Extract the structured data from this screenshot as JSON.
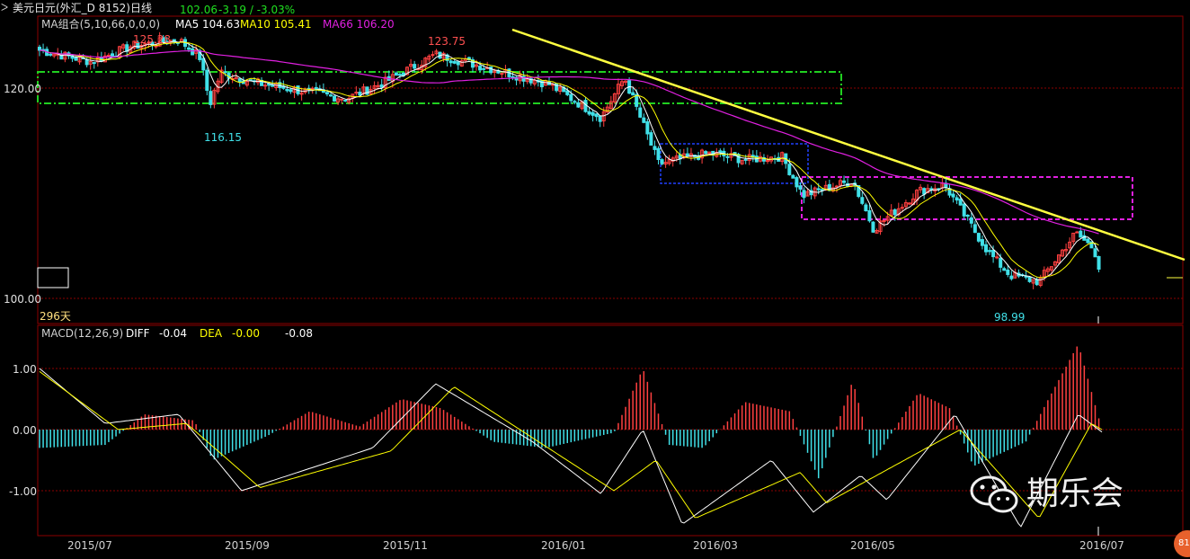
{
  "header": {
    "instrument_code_prefix": "ᐳ",
    "instrument": "美元日元(外汇_D 8152)日线",
    "last": "102.06",
    "change": "-3.19 / -3.03%"
  },
  "ma_legend": {
    "name": "MA组合(5,10,66,0,0,0)",
    "ma5": "MA5 104.63",
    "ma10": "MA10 105.41",
    "ma66": "MA66 106.20"
  },
  "macd_legend": {
    "name": "MACD(12,26,9)",
    "diff_label": "DIFF",
    "diff_value": "-0.04",
    "dea_label": "DEA",
    "dea_value": "-0.00",
    "macd_value": "-0.08"
  },
  "price_panel": {
    "y_ticks": [
      "120.00",
      "100.00"
    ],
    "annotations": {
      "high1": "125.28",
      "high2": "123.75",
      "low1": "116.15",
      "low2": "98.99"
    },
    "days_label": "296天"
  },
  "macd_panel": {
    "y_ticks": [
      "1.00",
      "0.00",
      "-1.00"
    ]
  },
  "x_axis": {
    "labels": [
      "2015/07",
      "2015/09",
      "2015/11",
      "2016/01",
      "2016/03",
      "2016/05",
      "2016/07"
    ]
  },
  "watermark": {
    "text": "期乐会"
  },
  "badge": {
    "text": "81"
  },
  "colors": {
    "bull": "#ff4040",
    "bear": "#40e0e8",
    "ma5": "#ffffff",
    "ma10": "#ffff00",
    "ma66": "#e020e0",
    "trendline": "#ffff40",
    "grid": "#8b0000",
    "box_green": "#20d020",
    "box_blue": "#2040ff",
    "box_magenta": "#e020e0"
  },
  "chart_data": {
    "type": "candlestick",
    "title": "美元日元(外汇_D 8152)日线",
    "price_ylim": [
      98,
      126.5
    ],
    "macd_ylim": [
      -1.75,
      1.1
    ],
    "x_range": [
      "2015/07",
      "2016/07"
    ],
    "price_anchors": [
      {
        "date": "2015/06/20",
        "close": 123.6
      },
      {
        "date": "2015/07/10",
        "close": 122.5
      },
      {
        "date": "2015/07/25",
        "close": 124.0
      },
      {
        "date": "2015/08/12",
        "close": 124.6
      },
      {
        "date": "2015/08/20",
        "close": 123.0
      },
      {
        "date": "2015/08/24",
        "close": 118.5
      },
      {
        "date": "2015/08/28",
        "close": 121.5
      },
      {
        "date": "2015/09/10",
        "close": 120.5
      },
      {
        "date": "2015/10/15",
        "close": 119.0
      },
      {
        "date": "2015/10/30",
        "close": 120.6
      },
      {
        "date": "2015/11/18",
        "close": 123.2
      },
      {
        "date": "2015/12/10",
        "close": 121.8
      },
      {
        "date": "2015/12/31",
        "close": 120.4
      },
      {
        "date": "2016/01/20",
        "close": 117.2
      },
      {
        "date": "2016/01/29",
        "close": 121.0
      },
      {
        "date": "2016/02/11",
        "close": 112.8
      },
      {
        "date": "2016/03/01",
        "close": 113.8
      },
      {
        "date": "2016/03/15",
        "close": 113.2
      },
      {
        "date": "2016/03/29",
        "close": 113.5
      },
      {
        "date": "2016/04/06",
        "close": 109.8
      },
      {
        "date": "2016/04/25",
        "close": 111.2
      },
      {
        "date": "2016/05/03",
        "close": 106.6
      },
      {
        "date": "2016/05/20",
        "close": 110.2
      },
      {
        "date": "2016/05/30",
        "close": 110.8
      },
      {
        "date": "2016/06/16",
        "close": 104.3
      },
      {
        "date": "2016/06/24",
        "close": 102.2
      },
      {
        "date": "2016/07/05",
        "close": 101.6
      },
      {
        "date": "2016/07/19",
        "close": 106.2
      },
      {
        "date": "2016/07/26",
        "close": 104.7
      },
      {
        "date": "2016/07/29",
        "close": 102.06
      }
    ],
    "macd_hist_anchors": [
      {
        "date": "2015/06/20",
        "value": -0.3
      },
      {
        "date": "2015/07/15",
        "value": -0.25
      },
      {
        "date": "2015/07/30",
        "value": 0.25
      },
      {
        "date": "2015/08/18",
        "value": 0.15
      },
      {
        "date": "2015/08/25",
        "value": -0.5
      },
      {
        "date": "2015/09/15",
        "value": -0.1
      },
      {
        "date": "2015/10/01",
        "value": 0.3
      },
      {
        "date": "2015/10/20",
        "value": 0.05
      },
      {
        "date": "2015/11/05",
        "value": 0.5
      },
      {
        "date": "2015/11/20",
        "value": 0.35
      },
      {
        "date": "2015/12/10",
        "value": -0.2
      },
      {
        "date": "2015/12/30",
        "value": -0.3
      },
      {
        "date": "2016/01/25",
        "value": -0.05
      },
      {
        "date": "2016/02/05",
        "value": 1.0
      },
      {
        "date": "2016/02/15",
        "value": -0.25
      },
      {
        "date": "2016/02/28",
        "value": -0.3
      },
      {
        "date": "2016/03/15",
        "value": 0.45
      },
      {
        "date": "2016/04/01",
        "value": 0.3
      },
      {
        "date": "2016/04/12",
        "value": -0.8
      },
      {
        "date": "2016/04/25",
        "value": 0.8
      },
      {
        "date": "2016/05/03",
        "value": -0.5
      },
      {
        "date": "2016/05/20",
        "value": 0.6
      },
      {
        "date": "2016/06/01",
        "value": 0.35
      },
      {
        "date": "2016/06/10",
        "value": -0.6
      },
      {
        "date": "2016/06/30",
        "value": -0.2
      },
      {
        "date": "2016/07/08",
        "value": 0.45
      },
      {
        "date": "2016/07/20",
        "value": 1.4
      },
      {
        "date": "2016/07/29",
        "value": 0.0
      }
    ],
    "diff_anchors": [
      {
        "date": "2015/06/20",
        "value": 1.0
      },
      {
        "date": "2015/07/15",
        "value": 0.1
      },
      {
        "date": "2015/08/12",
        "value": 0.25
      },
      {
        "date": "2015/09/05",
        "value": -1.0
      },
      {
        "date": "2015/10/25",
        "value": -0.3
      },
      {
        "date": "2015/11/18",
        "value": 0.75
      },
      {
        "date": "2015/12/25",
        "value": -0.2
      },
      {
        "date": "2016/01/20",
        "value": -1.05
      },
      {
        "date": "2016/02/05",
        "value": 0.0
      },
      {
        "date": "2016/02/20",
        "value": -1.55
      },
      {
        "date": "2016/03/25",
        "value": -0.5
      },
      {
        "date": "2016/04/10",
        "value": -1.35
      },
      {
        "date": "2016/04/28",
        "value": -0.75
      },
      {
        "date": "2016/05/08",
        "value": -1.15
      },
      {
        "date": "2016/06/03",
        "value": 0.25
      },
      {
        "date": "2016/06/28",
        "value": -1.6
      },
      {
        "date": "2016/07/20",
        "value": 0.25
      },
      {
        "date": "2016/07/29",
        "value": -0.04
      }
    ],
    "dea_anchors": [
      {
        "date": "2015/06/20",
        "value": 0.95
      },
      {
        "date": "2015/07/20",
        "value": 0.0
      },
      {
        "date": "2015/08/15",
        "value": 0.1
      },
      {
        "date": "2015/09/12",
        "value": -0.95
      },
      {
        "date": "2015/11/01",
        "value": -0.35
      },
      {
        "date": "2015/11/25",
        "value": 0.7
      },
      {
        "date": "2016/01/25",
        "value": -1.0
      },
      {
        "date": "2016/02/10",
        "value": -0.5
      },
      {
        "date": "2016/02/25",
        "value": -1.45
      },
      {
        "date": "2016/04/05",
        "value": -0.7
      },
      {
        "date": "2016/04/15",
        "value": -1.2
      },
      {
        "date": "2016/06/05",
        "value": 0.0
      },
      {
        "date": "2016/07/05",
        "value": -1.45
      },
      {
        "date": "2016/07/25",
        "value": 0.1
      },
      {
        "date": "2016/07/29",
        "value": -0.0
      }
    ]
  }
}
